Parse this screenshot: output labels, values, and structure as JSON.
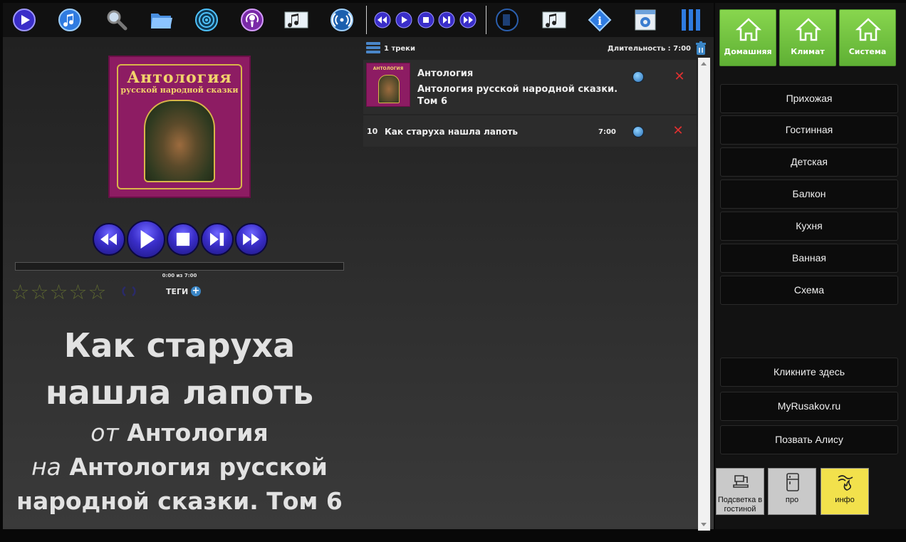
{
  "toolbar": {
    "icons": [
      "play-icon",
      "music-note-icon",
      "search-icon",
      "folder-icon",
      "radio-icon",
      "podcast-icon",
      "music-library-icon",
      "stream-icon",
      "rewind-icon",
      "play-icon",
      "stop-icon",
      "next-icon",
      "fast-forward-icon",
      "speaker-icon",
      "playlist-music-icon",
      "info-icon",
      "settings-icon",
      "columns-icon"
    ]
  },
  "album_cover": {
    "title_line1": "Антология",
    "title_line2": "русской народной сказки"
  },
  "player": {
    "progress_fraction": 0.0,
    "time_text": "0:00 из 7:00",
    "rating_stars": [
      "☆",
      "☆",
      "☆",
      "☆",
      "☆"
    ],
    "rating_value": 0,
    "tags_label": "ТЕГИ",
    "tags_add": "+"
  },
  "now_playing": {
    "title_line1": "Как старуха",
    "title_line2": "нашла лапоть",
    "by_prefix": "от",
    "artist": "Антология",
    "on_prefix": "на",
    "album_line1": "Антология русской",
    "album_line2": "народной сказки. Том 6"
  },
  "playlist": {
    "count_label": "1 треки",
    "duration_label": "Длительность : 7:00",
    "album": {
      "artist": "Антология",
      "name": "Антология русской народной сказки. Том 6",
      "thumb_text": "АНТОЛОГИЯ"
    },
    "tracks": [
      {
        "number": "10",
        "title": "Как старуха нашла лапоть",
        "duration": "7:00"
      }
    ],
    "delete_symbol": "✕"
  },
  "right_panel": {
    "home_buttons": [
      "Домашняя",
      "Климат",
      "Система"
    ],
    "rooms": [
      "Прихожая",
      "Гостинная",
      "Детская",
      "Балкон",
      "Кухня",
      "Ванная",
      "Схема"
    ],
    "links": [
      "Кликните здесь",
      "MyRusakov.ru",
      "Позвать Алису"
    ],
    "devices": [
      {
        "label": "Подсветка в гостиной",
        "icon": "lamp-icon",
        "color": "#c9c9c9"
      },
      {
        "label": "про",
        "icon": "fridge-icon",
        "color": "#c9c9c9"
      },
      {
        "label": "инфо",
        "icon": "heating-icon",
        "color": "#f2e14c"
      }
    ],
    "accent": "#6cc23e"
  }
}
